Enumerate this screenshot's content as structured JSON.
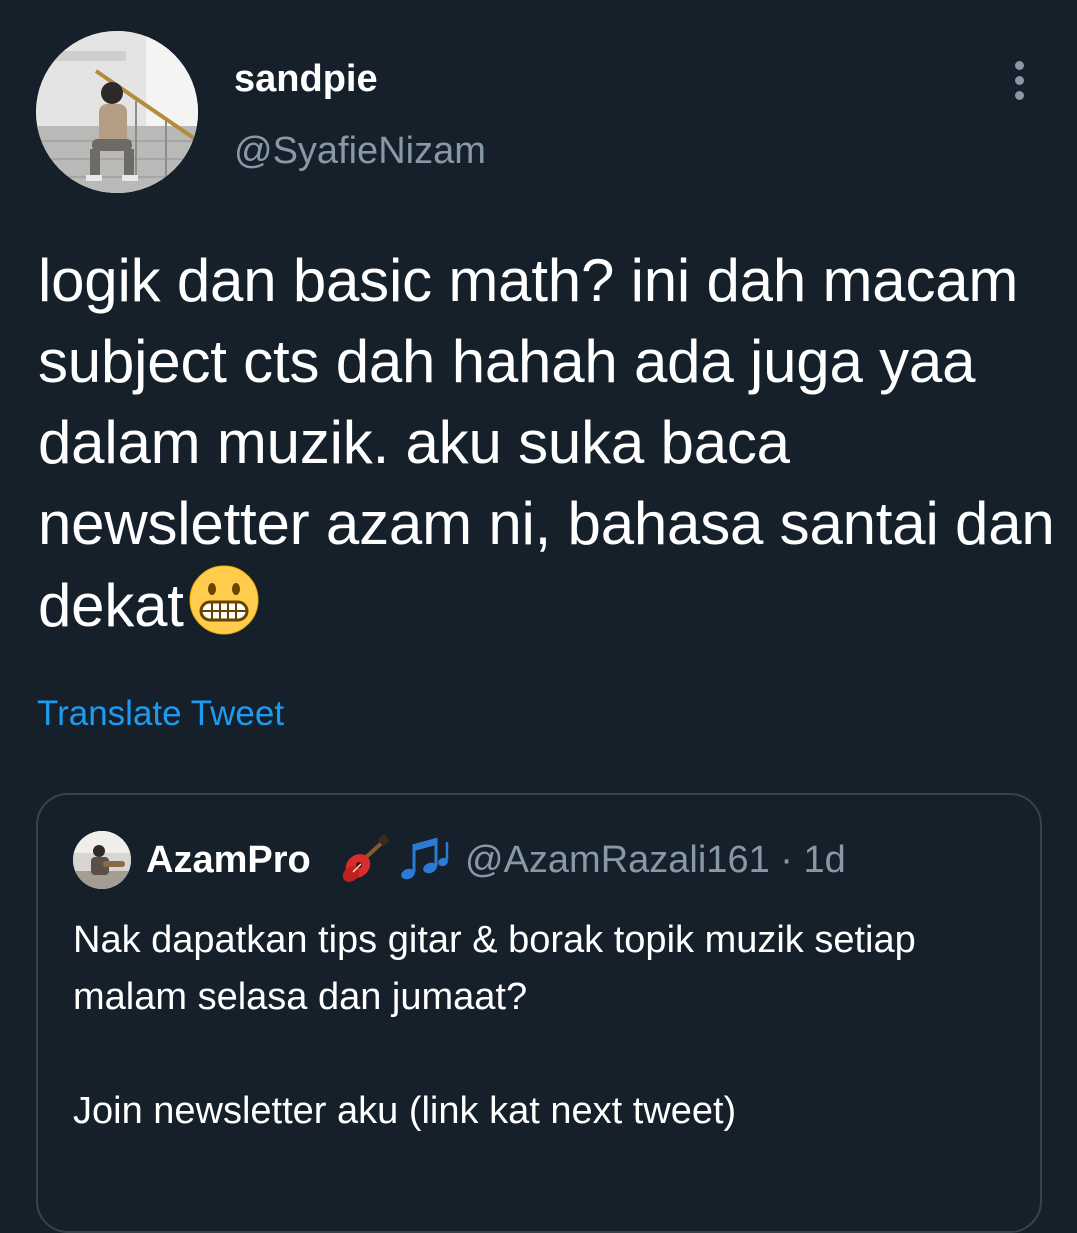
{
  "tweet": {
    "author_name": "sandpie",
    "author_handle": "@SyafieNizam",
    "text": "logik dan basic math? ini dah macam subject cts dah hahah ada juga yaa dalam muzik. aku suka baca newsletter azam ni, bahasa santai dan dekat",
    "emoji": "grimacing-face",
    "translate_label": "Translate Tweet"
  },
  "quoted_tweet": {
    "author_name": "AzamPro",
    "name_emojis": [
      "guitar",
      "musical-notes"
    ],
    "author_handle": "@AzamRazali161 · 1d",
    "text": "Nak dapatkan tips gitar & borak topik muzik setiap malam selasa dan jumaat?\n\nJoin newsletter aku (link kat next tweet)"
  },
  "colors": {
    "background": "#15202b",
    "secondary_text": "#8899a6",
    "link": "#1d9bf0",
    "card_border": "#38444d"
  }
}
